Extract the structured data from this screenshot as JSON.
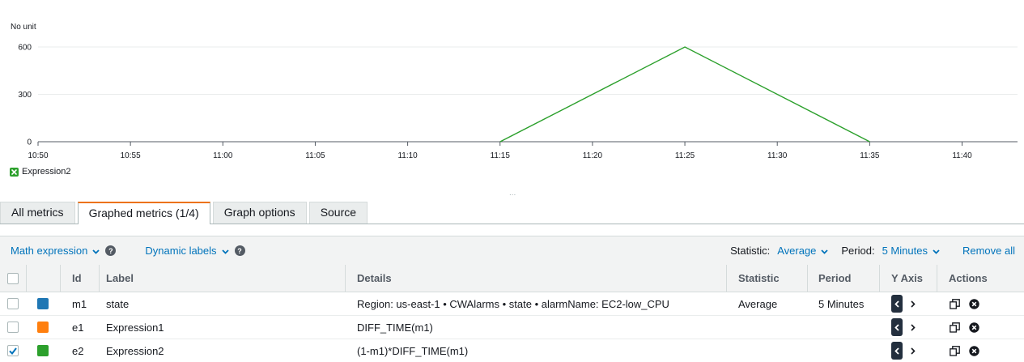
{
  "chart": {
    "unit_label": "No unit",
    "legend": [
      {
        "label": "Expression2",
        "color": "#2ca02c",
        "hidden": true
      }
    ],
    "resize_handle": "...",
    "chart_data": {
      "type": "line",
      "x_ticks": [
        "10:50",
        "10:55",
        "11:00",
        "11:05",
        "11:10",
        "11:15",
        "11:20",
        "11:25",
        "11:30",
        "11:35",
        "11:40"
      ],
      "y_ticks": [
        0,
        300,
        600
      ],
      "xlim": [
        "10:50",
        "11:43"
      ],
      "ylim": [
        0,
        600
      ],
      "grid": true,
      "series": [
        {
          "name": "Expression2",
          "color": "#2ca02c",
          "points": [
            [
              "11:15",
              0
            ],
            [
              "11:25",
              600
            ],
            [
              "11:35",
              0
            ]
          ]
        }
      ]
    }
  },
  "tabs": [
    {
      "label": "All metrics",
      "active": false
    },
    {
      "label": "Graphed metrics (1/4)",
      "active": true
    },
    {
      "label": "Graph options",
      "active": false
    },
    {
      "label": "Source",
      "active": false
    }
  ],
  "toolbar": {
    "math_expression": "Math expression",
    "dynamic_labels": "Dynamic labels",
    "help": "?",
    "statistic_label": "Statistic:",
    "statistic_value": "Average",
    "period_label": "Period:",
    "period_value": "5 Minutes",
    "remove_all": "Remove all"
  },
  "table": {
    "columns": [
      "Id",
      "Label",
      "Details",
      "Statistic",
      "Period",
      "Y Axis",
      "Actions"
    ],
    "rows": [
      {
        "checked": false,
        "color": "#1f77b4",
        "id": "m1",
        "label": "state",
        "details": "Region: us-east-1 • CWAlarms • state • alarmName: EC2-low_CPU",
        "statistic": "Average",
        "period": "5 Minutes"
      },
      {
        "checked": false,
        "color": "#ff7f0e",
        "id": "e1",
        "label": "Expression1",
        "details": "DIFF_TIME(m1)",
        "statistic": "",
        "period": ""
      },
      {
        "checked": true,
        "color": "#2ca02c",
        "id": "e2",
        "label": "Expression2",
        "details": "(1-m1)*DIFF_TIME(m1)",
        "statistic": "",
        "period": ""
      }
    ]
  }
}
